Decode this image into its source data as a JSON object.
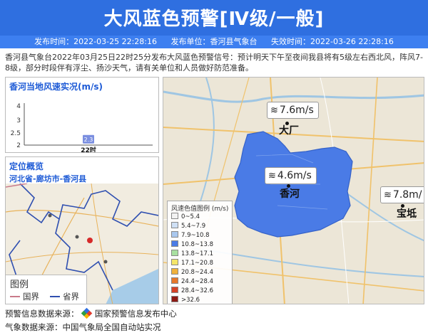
{
  "header": {
    "title": "大风蓝色预警[Ⅳ级/一般]",
    "publish_time": "发布时间：2022-03-25 22:28:16",
    "publisher": "发布单位：香河县气象台",
    "expire_time": "失效时间：2022-03-26 22:28:16"
  },
  "description": "香河县气象台2022年03月25日22时25分发布大风蓝色预警信号：预计明天下午至夜间我县将有5级左右西北风，阵风7-8级，部分时段伴有浮尘、扬沙天气，请有关单位和人员做好防范准备。",
  "wind_panel": {
    "title": "香河当地风速实况(m/s)",
    "chart_data": {
      "type": "bar",
      "categories": [
        "22时"
      ],
      "values": [
        2.3
      ],
      "ylabel": "",
      "ylim": [
        2,
        4
      ],
      "yticks": [
        "4",
        "3",
        "2.5",
        "2"
      ],
      "data_labels": [
        "2.3"
      ]
    }
  },
  "location_panel": {
    "title": "定位概览",
    "region": "河北省-廊坊市-香河县",
    "legend_title": "图例",
    "legend_items": [
      {
        "label": "国界",
        "color": "#c97a8a"
      },
      {
        "label": "省界",
        "color": "#2f4fb0"
      }
    ]
  },
  "main_map": {
    "stations": [
      {
        "label": "大厂",
        "wind": "7.6m/s"
      },
      {
        "label": "香河",
        "wind": "4.6m/s"
      },
      {
        "label": "宝坻",
        "wind": "7.8m/"
      }
    ],
    "legend_title": "风速色值图例 (m/s)",
    "legend_items": [
      {
        "label": "0~5.4",
        "color": "#f2f2f2"
      },
      {
        "label": "5.4~7.9",
        "color": "#cfe0f5"
      },
      {
        "label": "7.9~10.8",
        "color": "#a9c8ee"
      },
      {
        "label": "10.8~13.8",
        "color": "#4a7be6"
      },
      {
        "label": "13.8~17.1",
        "color": "#a8e0a0"
      },
      {
        "label": "17.1~20.8",
        "color": "#f4e66a"
      },
      {
        "label": "20.8~24.4",
        "color": "#f0b23c"
      },
      {
        "label": "24.4~28.4",
        "color": "#e7782a"
      },
      {
        "label": "28.4~32.6",
        "color": "#d64226"
      },
      {
        "label": ">32.6",
        "color": "#8e1a14"
      }
    ]
  },
  "footer": {
    "warning_source": "预警信息数据来源：",
    "warning_source_name": "国家预警信息发布中心",
    "weather_source": "气象数据来源：中国气象局全国自动站实况"
  },
  "colors": {
    "header_blue": "#2f6fe0",
    "meta_blue": "#3d7ff0",
    "region_blue": "#4a7be6",
    "panel_title_blue": "#1e5bd6"
  }
}
